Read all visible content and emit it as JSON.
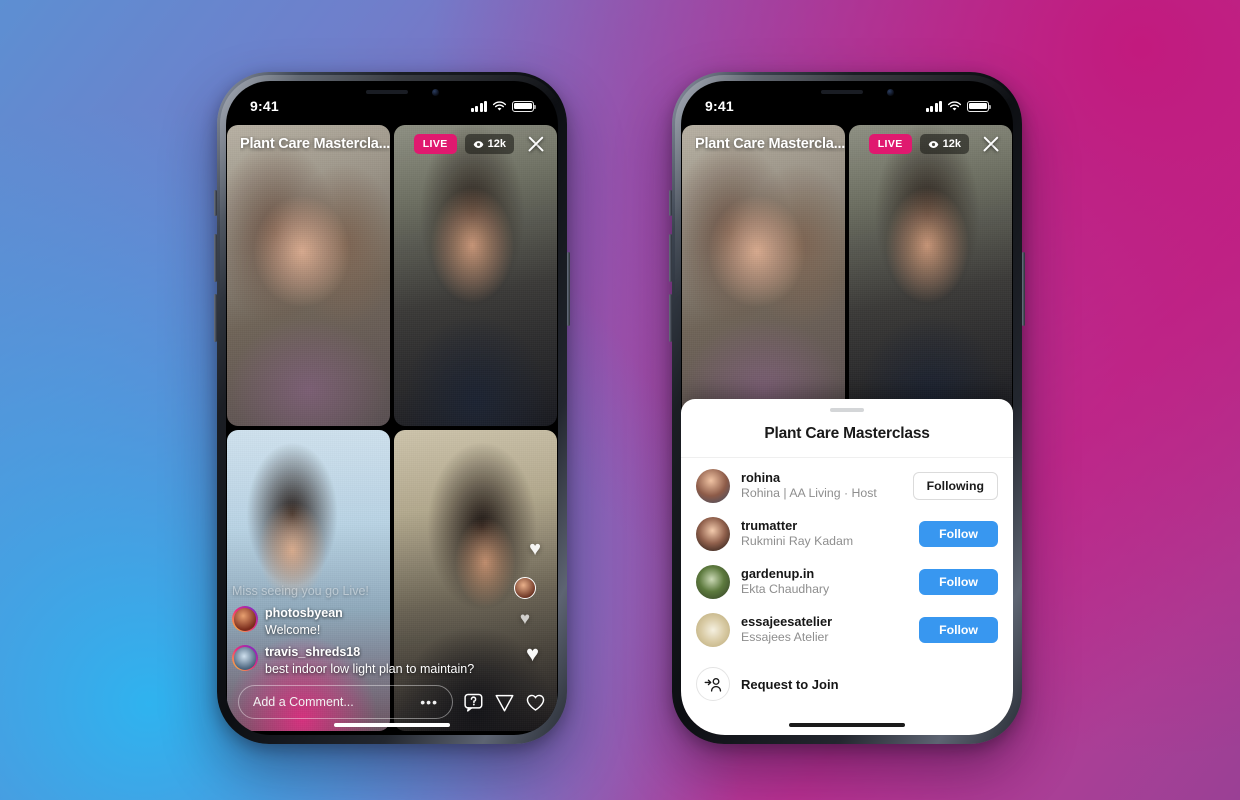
{
  "background": {
    "gradient_from": "#5d8fd2",
    "gradient_mid": "#a84aa6",
    "gradient_to": "#9a4095",
    "accent_cyan": "#2fb3ef",
    "accent_magenta": "#c21a7e"
  },
  "status_bar": {
    "time": "9:41",
    "signal_icon": "signal-bars-icon",
    "wifi_icon": "wifi-icon",
    "battery_icon": "battery-icon"
  },
  "live": {
    "title": "Plant Care Mastercla...",
    "live_badge": "LIVE",
    "viewer_count": "12k",
    "eye_icon": "eye-icon",
    "close_icon": "close-icon"
  },
  "comments": [
    {
      "username": "",
      "text": "Miss seeing you go Live!",
      "avatar": "commenter-avatar",
      "state": "fading"
    },
    {
      "username": "photosbyean",
      "text": "Welcome!",
      "avatar": "commenter-avatar",
      "state": "visible"
    },
    {
      "username": "travis_shreds18",
      "text": "best indoor low light plan to maintain?",
      "avatar": "commenter-avatar",
      "state": "visible"
    }
  ],
  "bottom_bar": {
    "comment_placeholder": "Add a Comment...",
    "more_dots": "•••",
    "question_icon": "question-bubble-icon",
    "send_icon": "send-icon",
    "heart_icon": "heart-icon"
  },
  "hearts": {
    "glyph": "♥"
  },
  "sheet": {
    "title": "Plant Care Masterclass",
    "grabber": "sheet-grabber",
    "participants": [
      {
        "username": "rohina",
        "subtitle": "Rohina | AA Living · Host",
        "action": "Following",
        "action_style": "following"
      },
      {
        "username": "trumatter",
        "subtitle": "Rukmini Ray Kadam",
        "action": "Follow",
        "action_style": "follow"
      },
      {
        "username": "gardenup.in",
        "subtitle": "Ekta Chaudhary",
        "action": "Follow",
        "action_style": "follow"
      },
      {
        "username": "essajeesatelier",
        "subtitle": "Essajees Atelier",
        "action": "Follow",
        "action_style": "follow"
      }
    ],
    "request_to_join": {
      "label": "Request to Join",
      "icon": "add-person-icon"
    },
    "follow_color": "#3897f0"
  }
}
